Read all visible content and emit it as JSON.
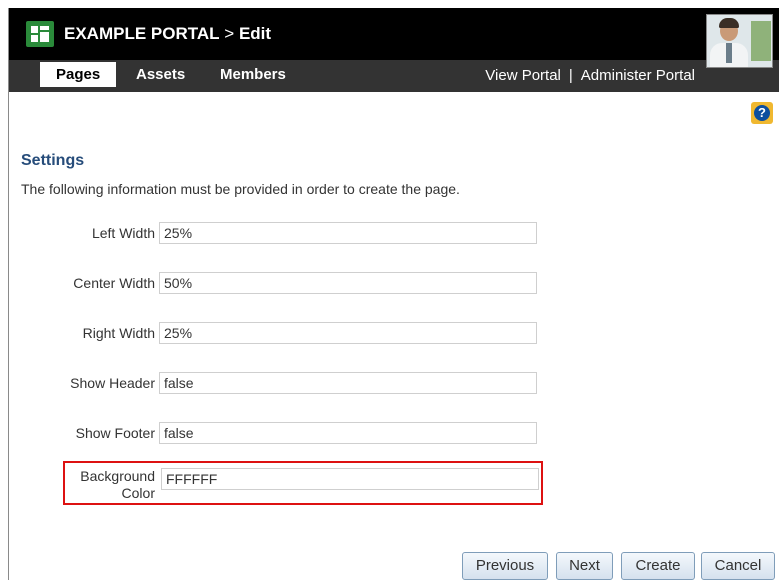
{
  "header": {
    "portal_name": "EXAMPLE PORTAL",
    "separator": ">",
    "mode": "Edit"
  },
  "nav": {
    "tabs": [
      {
        "label": "Pages"
      },
      {
        "label": "Assets"
      },
      {
        "label": "Members"
      }
    ],
    "links": {
      "view": "View Portal",
      "divider": "|",
      "administer": "Administer Portal"
    }
  },
  "help": {
    "icon": "help-icon",
    "glyph": "?"
  },
  "settings": {
    "title": "Settings",
    "intro": "The following information must be provided in order to create the page.",
    "fields": [
      {
        "label": "Left Width",
        "value": "25%"
      },
      {
        "label": "Center Width",
        "value": "50%"
      },
      {
        "label": "Right Width",
        "value": "25%"
      },
      {
        "label": "Show Header",
        "value": "false"
      },
      {
        "label": "Show Footer",
        "value": "false"
      },
      {
        "label_line1": "Background",
        "label_line2": "Color",
        "value": "FFFFFF"
      }
    ]
  },
  "buttons": {
    "previous": "Previous",
    "next": "Next",
    "create": "Create",
    "cancel": "Cancel"
  },
  "colors": {
    "header_bg": "#000000",
    "nav_bg": "#333333",
    "title_color": "#264c7a",
    "highlight": "#dd1111"
  }
}
